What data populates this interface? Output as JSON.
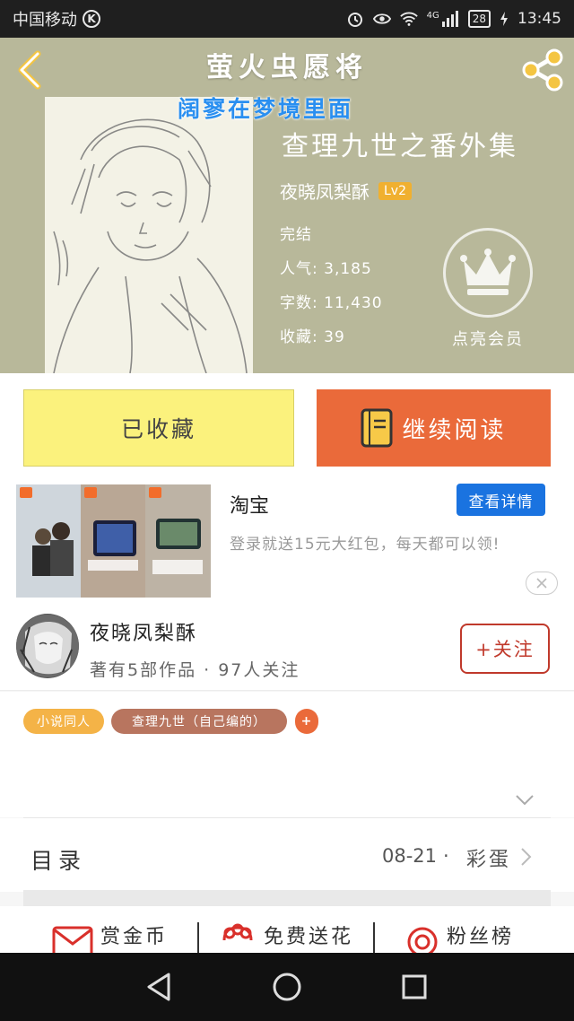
{
  "status_bar": {
    "carrier": "中国移动",
    "k_badge": "K",
    "network": "4G",
    "battery": "28",
    "time": "13:45"
  },
  "header": {
    "site_title": "萤火虫愿将",
    "cover_overlay": "阔寥在梦境里面",
    "book_title": "查理九世之番外集",
    "author": "夜晓凤梨酥",
    "level": "Lv2",
    "status": "完结",
    "popularity": "人气: 3,185",
    "word_count": "字数: 11,430",
    "collections": "收藏: 39",
    "vip_label": "点亮会员"
  },
  "actions": {
    "favorite": "已收藏",
    "continue": "继续阅读"
  },
  "ad": {
    "title": "淘宝",
    "button": "查看详情",
    "description": "登录就送15元大红包，每天都可以领!"
  },
  "author": {
    "name": "夜晓凤梨酥",
    "summary": "著有5部作品 · 97人关注",
    "follow": "+关注"
  },
  "tags": [
    {
      "label": "小说同人",
      "color": "#f4b347"
    },
    {
      "label": "查理九世（自己编的）",
      "color": "#b8755f"
    },
    {
      "label": "+",
      "color": "#ea6a3a"
    }
  ],
  "toc": {
    "label": "目录",
    "date": "08-21",
    "separator": "·",
    "extra": "彩蛋"
  },
  "bottom": {
    "reward": "赏金币",
    "flowers": "免费送花",
    "fans": "粉丝榜"
  },
  "icons": [
    "back-icon",
    "share-icon",
    "crown-icon",
    "book-icon",
    "close-icon",
    "chevron-down-icon",
    "chevron-right-icon",
    "envelope-icon",
    "flower-icon",
    "target-icon",
    "nav-back-icon",
    "nav-home-icon",
    "nav-recent-icon"
  ],
  "colors": {
    "header_bg": "#b8b89a",
    "fav_button": "#fbf27d",
    "read_button": "#ea6a3a",
    "ad_button": "#1a73e0",
    "follow": "#c0392b"
  }
}
